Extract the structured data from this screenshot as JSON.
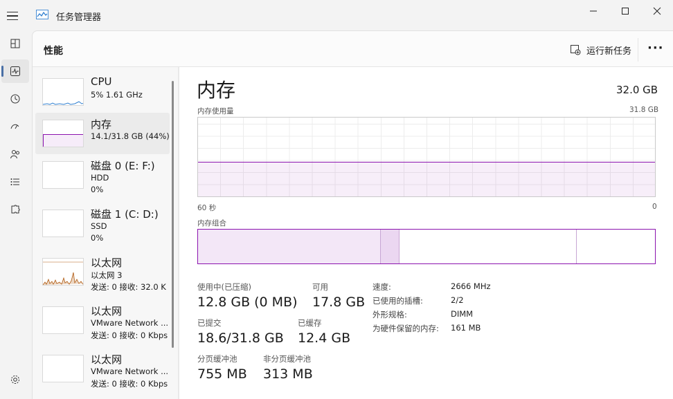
{
  "window": {
    "title": "任务管理器"
  },
  "header": {
    "title": "性能",
    "run_task": "运行新任务"
  },
  "devices": [
    {
      "name": "CPU",
      "sub": "5% 1.61 GHz",
      "sub2": ""
    },
    {
      "name": "内存",
      "sub": "14.1/31.8 GB (44%)",
      "sub2": ""
    },
    {
      "name": "磁盘 0 (E: F:)",
      "sub": "HDD",
      "sub2": "0%"
    },
    {
      "name": "磁盘 1 (C: D:)",
      "sub": "SSD",
      "sub2": "0%"
    },
    {
      "name": "以太网",
      "sub": "以太网 3",
      "sub2": "发送: 0 接收: 32.0 K"
    },
    {
      "name": "以太网",
      "sub": "VMware Network ...",
      "sub2": "发送: 0 接收: 0 Kbps"
    },
    {
      "name": "以太网",
      "sub": "VMware Network ...",
      "sub2": "发送: 0 接收: 0 Kbps"
    }
  ],
  "memory": {
    "title": "内存",
    "total": "32.0 GB",
    "usage_label": "内存使用量",
    "usage_max": "31.8 GB",
    "axis_left": "60 秒",
    "axis_right": "0",
    "usage_fraction": 0.44,
    "composition_label": "内存组合",
    "composition": {
      "in_use": 12.8,
      "modified": 1.3,
      "standby": 12.4,
      "free": 5.5
    },
    "stats": {
      "in_use_label": "使用中(已压缩)",
      "in_use_value": "12.8 GB (0 MB)",
      "available_label": "可用",
      "available_value": "17.8 GB",
      "committed_label": "已提交",
      "committed_value": "18.6/31.8 GB",
      "cached_label": "已缓存",
      "cached_value": "12.4 GB",
      "paged_label": "分页缓冲池",
      "paged_value": "755 MB",
      "nonpaged_label": "非分页缓冲池",
      "nonpaged_value": "313 MB"
    },
    "specs": [
      {
        "k": "速度:",
        "v": "2666 MHz"
      },
      {
        "k": "已使用的插槽:",
        "v": "2/2"
      },
      {
        "k": "外形规格:",
        "v": "DIMM"
      },
      {
        "k": "为硬件保留的内存:",
        "v": "161 MB"
      }
    ]
  },
  "colors": {
    "memory": "#8b12ae",
    "cpu": "#2f7fd0",
    "ethernet": "#b05a10",
    "nav_accent": "#4a6fa5"
  }
}
